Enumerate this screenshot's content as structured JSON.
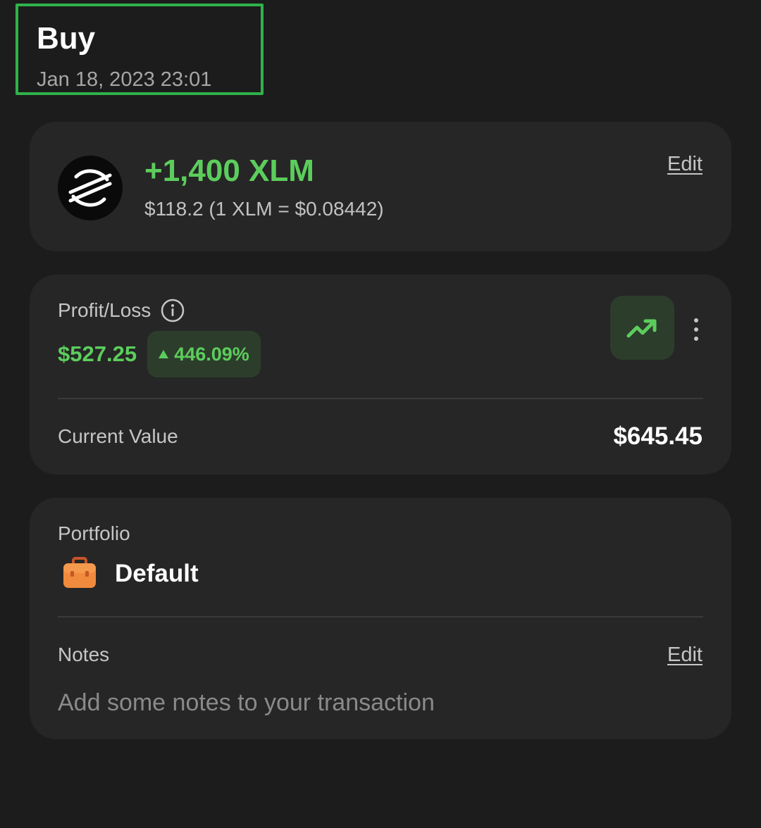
{
  "header": {
    "title": "Buy",
    "date": "Jan 18, 2023 23:01"
  },
  "transaction": {
    "coin_icon": "stellar-logo-icon",
    "amount": "+1,400 XLM",
    "subtitle": "$118.2 (1 XLM = $0.08442)",
    "edit_label": "Edit"
  },
  "profit_loss": {
    "label": "Profit/Loss",
    "info_icon": "info-icon",
    "value": "$527.25",
    "percent": "446.09%",
    "trend_icon": "trending-up-icon",
    "more_icon": "more-vertical-icon",
    "current_value_label": "Current Value",
    "current_value": "$645.45"
  },
  "portfolio": {
    "label": "Portfolio",
    "icon": "briefcase-icon",
    "name": "Default",
    "notes_label": "Notes",
    "notes_edit_label": "Edit",
    "notes_placeholder": "Add some notes to your transaction"
  },
  "colors": {
    "background": "#1c1c1c",
    "card": "#262626",
    "positive": "#5ccd5c",
    "positive_bg": "#2c3d2c",
    "highlight_border": "#2fb14a",
    "briefcase": "#f08a3c"
  }
}
